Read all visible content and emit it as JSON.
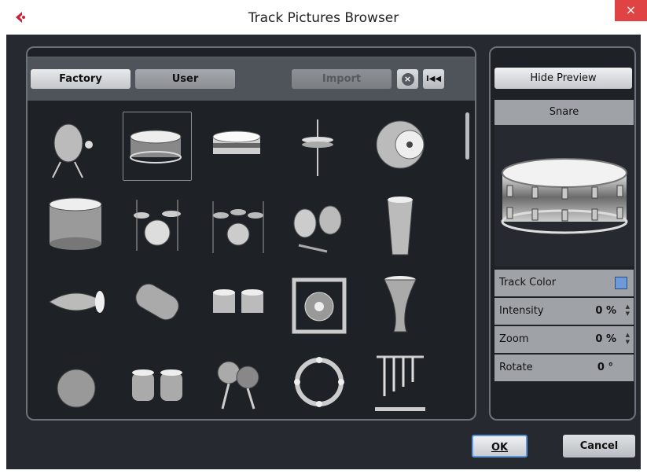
{
  "window": {
    "title": "Track Pictures Browser",
    "close_glyph": "×"
  },
  "toolbar": {
    "factory_label": "Factory",
    "user_label": "User",
    "import_label": "Import",
    "delete_glyph": "×",
    "skip_glyph": "I◀◀"
  },
  "pictures": [
    {
      "name": "bass-drum-stand-icon"
    },
    {
      "name": "snare-icon",
      "selected": true
    },
    {
      "name": "snare-chrome-icon"
    },
    {
      "name": "hihat-stand-icon"
    },
    {
      "name": "cymbal-icon"
    },
    {
      "name": "floor-tom-icon"
    },
    {
      "name": "drum-kit-icon"
    },
    {
      "name": "drum-kit-large-icon"
    },
    {
      "name": "percussion-set-icon"
    },
    {
      "name": "conga-icon"
    },
    {
      "name": "mridangam-icon"
    },
    {
      "name": "dholak-icon"
    },
    {
      "name": "bongos-icon"
    },
    {
      "name": "gong-icon"
    },
    {
      "name": "djembe-icon"
    },
    {
      "name": "shaker-gourd-icon"
    },
    {
      "name": "tabla-icon"
    },
    {
      "name": "maracas-icon"
    },
    {
      "name": "tambourine-icon"
    },
    {
      "name": "chimes-icon"
    }
  ],
  "preview": {
    "hide_label": "Hide Preview",
    "selected_name": "Snare",
    "track_color_label": "Track Color",
    "track_color": "#6f9ad9",
    "intensity_label": "Intensity",
    "intensity_value": "0 %",
    "zoom_label": "Zoom",
    "zoom_value": "0 %",
    "rotate_label": "Rotate",
    "rotate_value": "0 °"
  },
  "footer": {
    "ok_label": "OK",
    "cancel_label": "Cancel"
  }
}
